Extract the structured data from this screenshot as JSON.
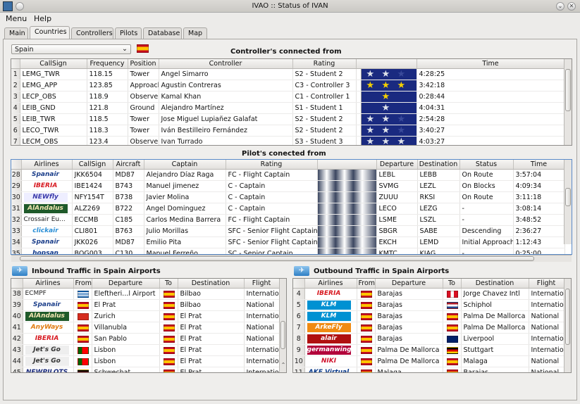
{
  "window": {
    "title": "IVAO :: Status of IVAN"
  },
  "menu": [
    "Menu",
    "Help"
  ],
  "tabs": [
    "Main",
    "Countries",
    "Controllers",
    "Pilots",
    "Database",
    "Map"
  ],
  "country_select": {
    "value": "Spain",
    "flag_color": "#c60b1e"
  },
  "controllers": {
    "title": "Controller's connected from",
    "columns": [
      "CallSign",
      "Frequency",
      "Position",
      "Controller",
      "Rating",
      "",
      "Time"
    ],
    "rows": [
      {
        "n": "1",
        "cs": "LEMG_TWR",
        "freq": "118.15",
        "pos": "Tower",
        "name": "Angel Simarro",
        "rating": "S2 - Student 2",
        "stars": 2,
        "time": "4:28:25"
      },
      {
        "n": "2",
        "cs": "LEMG_APP",
        "freq": "123.85",
        "pos": "Approach",
        "name": "Agustin Contreras",
        "rating": "C3 - Controller 3",
        "stars": 3,
        "time": "3:42:18"
      },
      {
        "n": "3",
        "cs": "LECP_OBS",
        "freq": "118.9",
        "pos": "Observer",
        "name": "Kamal Khan",
        "rating": "C1 - Controller 1",
        "stars": 1,
        "time": "0:28:44"
      },
      {
        "n": "4",
        "cs": "LEIB_GND",
        "freq": "121.8",
        "pos": "Ground",
        "name": "Alejandro Martínez",
        "rating": "S1 - Student 1",
        "stars": 1,
        "time": "4:04:31"
      },
      {
        "n": "5",
        "cs": "LEIB_TWR",
        "freq": "118.5",
        "pos": "Tower",
        "name": "Jose Miguel Lupiañez Galafat",
        "rating": "S2 - Student 2",
        "stars": 2,
        "time": "2:54:28"
      },
      {
        "n": "6",
        "cs": "LECO_TWR",
        "freq": "118.3",
        "pos": "Tower",
        "name": "Iván Bestilleiro Fernández",
        "rating": "S2 - Student 2",
        "stars": 2,
        "time": "3:40:27"
      },
      {
        "n": "7",
        "cs": "LECM_OBS",
        "freq": "123.4",
        "pos": "Observer",
        "name": "Ivan Turrado",
        "rating": "S3 - Student 3",
        "stars": 3,
        "time": "4:03:27"
      }
    ]
  },
  "pilots": {
    "title": "Pilot's conected from",
    "columns": [
      "Airlines",
      "CallSign",
      "Aircraft",
      "Captain",
      "Rating",
      "",
      "Departure",
      "Destination",
      "Status",
      "Time"
    ],
    "rows": [
      {
        "n": "28",
        "airline": "Spanair",
        "cs": "JKK6504",
        "ac": "MD87",
        "cap": "Alejandro Díaz Raga",
        "rating": "FC - Flight Captain",
        "dep": "LEBL",
        "dest": "LEBB",
        "status": "On Route",
        "time": "3:57:04"
      },
      {
        "n": "29",
        "airline": "IBERIA",
        "cs": "IBE1424",
        "ac": "B743",
        "cap": "Manuel jimenez",
        "rating": "C - Captain",
        "dep": "SVMG",
        "dest": "LEZL",
        "status": "On Blocks",
        "time": "4:09:34"
      },
      {
        "n": "30",
        "airline": "NEWfly",
        "cs": "NFY154T",
        "ac": "B738",
        "cap": "Javier Molina",
        "rating": "C - Captain",
        "dep": "ZUUU",
        "dest": "RKSI",
        "status": "On Route",
        "time": "3:11:18"
      },
      {
        "n": "31",
        "airline": "AlAndalus",
        "cs": "ALZ269",
        "ac": "B722",
        "cap": "Angel Dominguez",
        "rating": "C - Captain",
        "dep": "LECO",
        "dest": "LEZG",
        "status": "-",
        "time": "3:08:14"
      },
      {
        "n": "32",
        "airline": "Crossair Eu...",
        "cs": "ECCMB",
        "ac": "C185",
        "cap": "Carlos Medina Barrera",
        "rating": "FC - Flight Captain",
        "dep": "LSME",
        "dest": "LSZL",
        "status": "-",
        "time": "3:48:52"
      },
      {
        "n": "33",
        "airline": "clickair",
        "cs": "CLI801",
        "ac": "B763",
        "cap": "Julio Morillas",
        "rating": "SFC - Senior Flight Captain",
        "dep": "SBGR",
        "dest": "SABE",
        "status": "Descending",
        "time": "2:36:27"
      },
      {
        "n": "34",
        "airline": "Spanair",
        "cs": "JKK026",
        "ac": "MD87",
        "cap": "Emilio Pita",
        "rating": "SFC - Senior Flight Captain",
        "dep": "EKCH",
        "dest": "LEMD",
        "status": "Initial Approach",
        "time": "1:12:43"
      },
      {
        "n": "35",
        "airline": "hopsan",
        "cs": "BOG003",
        "ac": "C130",
        "cap": "Manuel Ferreño",
        "rating": "SC - Senior Captain",
        "dep": "KMTC",
        "dest": "KIAG",
        "status": "-",
        "time": "0:25:00"
      }
    ]
  },
  "inbound": {
    "title": "Inbound Traffic in Spain Airports",
    "columns": [
      "Airlines",
      "From",
      "Departure",
      "To",
      "Destination",
      "Flight"
    ],
    "rows": [
      {
        "n": "38",
        "airline": "ECMPF",
        "from": "fGR",
        "dep": "Eleftheri...l Airport",
        "to": "fES",
        "dest": "Bilbao",
        "flight": "International"
      },
      {
        "n": "39",
        "airline": "Spanair",
        "from": "fES",
        "dep": "El Prat",
        "to": "fES",
        "dest": "Bilbao",
        "flight": "National"
      },
      {
        "n": "40",
        "airline": "AlAndalus",
        "from": "fCH",
        "dep": "Zurich",
        "to": "fES",
        "dest": "El Prat",
        "flight": "International"
      },
      {
        "n": "41",
        "airline": "AnyWays",
        "from": "fES",
        "dep": "Villanubla",
        "to": "fES",
        "dest": "El Prat",
        "flight": "National"
      },
      {
        "n": "42",
        "airline": "IBERIA",
        "from": "fES",
        "dep": "San Pablo",
        "to": "fES",
        "dest": "El Prat",
        "flight": "National"
      },
      {
        "n": "43",
        "airline": "Jet's Go",
        "from": "fPT",
        "dep": "Lisbon",
        "to": "fES",
        "dest": "El Prat",
        "flight": "International"
      },
      {
        "n": "44",
        "airline": "Jet's Go",
        "from": "fPT",
        "dep": "Lisbon",
        "to": "fES",
        "dest": "El Prat",
        "flight": "International"
      },
      {
        "n": "45",
        "airline": "NEWPILOTS",
        "from": "fDE",
        "dep": "Schwechat",
        "to": "fES",
        "dest": "El Prat",
        "flight": "International"
      }
    ]
  },
  "outbound": {
    "title": "Outbound Traffic in Spain Airports",
    "columns": [
      "Airlines",
      "From",
      "Departure",
      "To",
      "Destination",
      "Flight"
    ],
    "rows": [
      {
        "n": "4",
        "airline": "IBERIA",
        "from": "fES",
        "dep": "Barajas",
        "to": "fPE",
        "dest": "Jorge Chavez Intl",
        "flight": "International"
      },
      {
        "n": "5",
        "airline": "KLM",
        "from": "fES",
        "dep": "Barajas",
        "to": "fNL",
        "dest": "Schiphol",
        "flight": "International"
      },
      {
        "n": "6",
        "airline": "KLM",
        "from": "fES",
        "dep": "Barajas",
        "to": "fES",
        "dest": "Palma De Mallorca",
        "flight": "National"
      },
      {
        "n": "7",
        "airline": "ArkeFly",
        "from": "fES",
        "dep": "Barajas",
        "to": "fES",
        "dest": "Palma De Mallorca",
        "flight": "National"
      },
      {
        "n": "8",
        "airline": "alair",
        "from": "fES",
        "dep": "Barajas",
        "to": "fGB",
        "dest": "Liverpool",
        "flight": "International"
      },
      {
        "n": "9",
        "airline": "germanwings",
        "from": "fES",
        "dep": "Palma De Mallorca",
        "to": "fDE",
        "dest": "Stuttgart",
        "flight": "International"
      },
      {
        "n": "10",
        "airline": "NIKI",
        "from": "fES",
        "dep": "Palma De Mallorca",
        "to": "fES",
        "dest": "Malaga",
        "flight": "National"
      },
      {
        "n": "11",
        "airline": "AKE Virtual",
        "from": "fES",
        "dep": "Malaga",
        "to": "fES",
        "dest": "Barajas",
        "flight": "National"
      }
    ]
  }
}
